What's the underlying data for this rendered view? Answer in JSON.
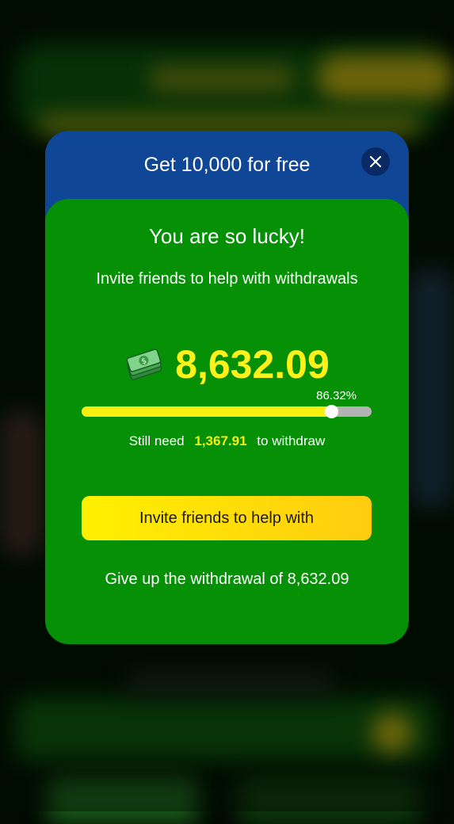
{
  "modal": {
    "title": "Get 10,000 for free",
    "close_icon": "close-icon",
    "heading": "You are so lucky!",
    "subtitle": "Invite friends to help with withdrawals",
    "money_icon": "cash-stack-icon",
    "amount": "8,632.09",
    "progress_label": "86.32%",
    "progress_value": 0.8632,
    "still_need_prefix": "Still need",
    "still_need_value": "1,367.91",
    "still_need_suffix": "to withdraw",
    "invite_button_label": "Invite friends to help with",
    "give_up_label": "Give up the withdrawal of 8,632.09"
  },
  "colors": {
    "header": "#0f4696",
    "body": "#059005",
    "accent_yellow": "#f6ef10",
    "button_gradient_start": "#fff000",
    "button_gradient_end": "#ffcc10"
  }
}
